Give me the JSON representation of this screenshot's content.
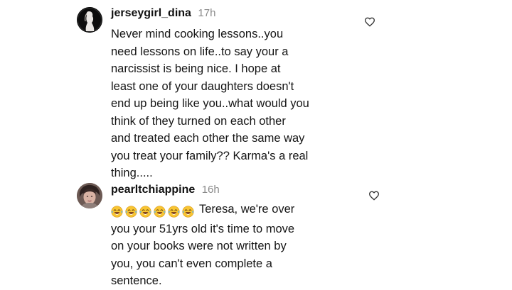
{
  "comments": [
    {
      "username": "jerseygirl_dina",
      "time": "17h",
      "text": "Never mind cooking lessons..you\nneed lessons on life..to say your a\nnarcissist is being nice.  I hope at\nleast one of your daughters doesn't\nend up being like you..what would you\nthink of they turned on each other\nand treated each other the same way\nyou treat your family?? Karma's a real\nthing.....",
      "avatar_icon": "profile-avatar",
      "like_icon": "heart-outline-icon"
    },
    {
      "username": "pearltchiappine",
      "time": "16h",
      "emoji_icon": "face-with-tears-of-joy-emoji",
      "emoji_count": 6,
      "text": "Teresa, we're over\nyou your 51yrs old it's time to move\non your books were not written by\nyou, you can't even complete a\nsentence.",
      "avatar_icon": "profile-avatar",
      "like_icon": "heart-outline-icon"
    }
  ],
  "colors": {
    "text": "#151515",
    "timestamp": "#8a8a8a",
    "heart_outline": "#333333",
    "emoji_face": "#f8c533"
  }
}
